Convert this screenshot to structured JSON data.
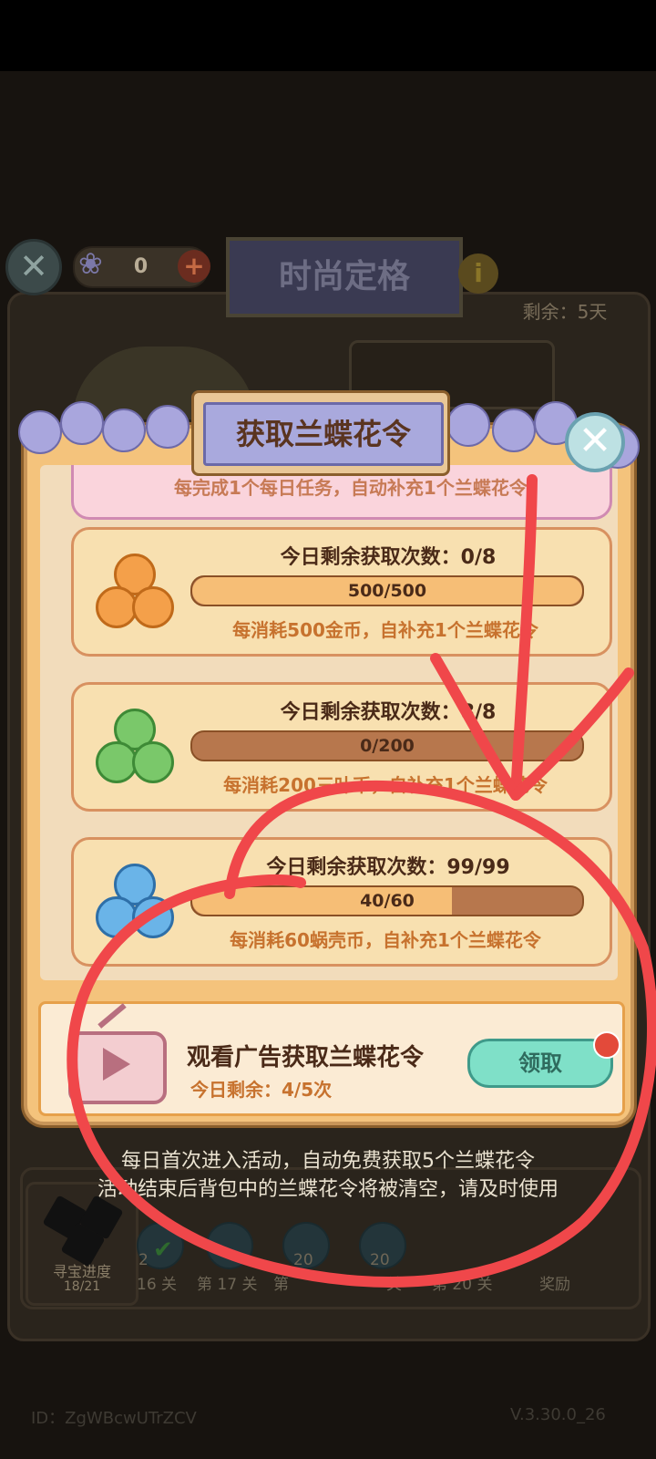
{
  "background": {
    "currency_count": "0",
    "event_title": "时尚定格",
    "remaining_days": "剩余：5天",
    "treasure_progress_label": "寻宝进度",
    "treasure_progress_count": "18/21",
    "levels": [
      "16 关",
      "第 17 关",
      "第",
      "关",
      "第 20 关",
      "奖励"
    ],
    "level_icon_numbers": [
      "2",
      "20",
      "20"
    ]
  },
  "dialog": {
    "title": "获取兰蝶花令",
    "daily_task_text": "每完成1个每日任务，自动补充1个兰蝶花令",
    "cards": [
      {
        "title": "今日剩余获取次数：0/8",
        "bar_label": "500/500",
        "fill_ratio": 1.0,
        "sub": "每消耗500金币，自补充1个兰蝶花令",
        "coin_color": "#f4a04a"
      },
      {
        "title": "今日剩余获取次数：8/8",
        "bar_label": "0/200",
        "fill_ratio": 0.0,
        "sub": "每消耗200三叶币，自补充1个兰蝶花令",
        "coin_color": "#7ac86a"
      },
      {
        "title": "今日剩余获取次数：99/99",
        "bar_label": "40/60",
        "fill_ratio": 0.667,
        "sub": "每消耗60蜗壳币，自补充1个兰蝶花令",
        "coin_color": "#6ab4e8"
      }
    ],
    "ad": {
      "title": "观看广告获取兰蝶花令",
      "remaining": "今日剩余：4/5次",
      "claim_label": "领取"
    }
  },
  "notice": {
    "line1": "每日首次进入活动，自动免费获取5个兰蝶花令",
    "line2": "活动结束后背包中的兰蝶花令将被清空，请及时使用"
  },
  "footer": {
    "id": "ID：ZgWBcwUTrZCV",
    "version": "V.3.30.0_26"
  },
  "colors": {
    "annotation_red": "#f0474a",
    "dialog_bg": "#f2dcbb"
  }
}
